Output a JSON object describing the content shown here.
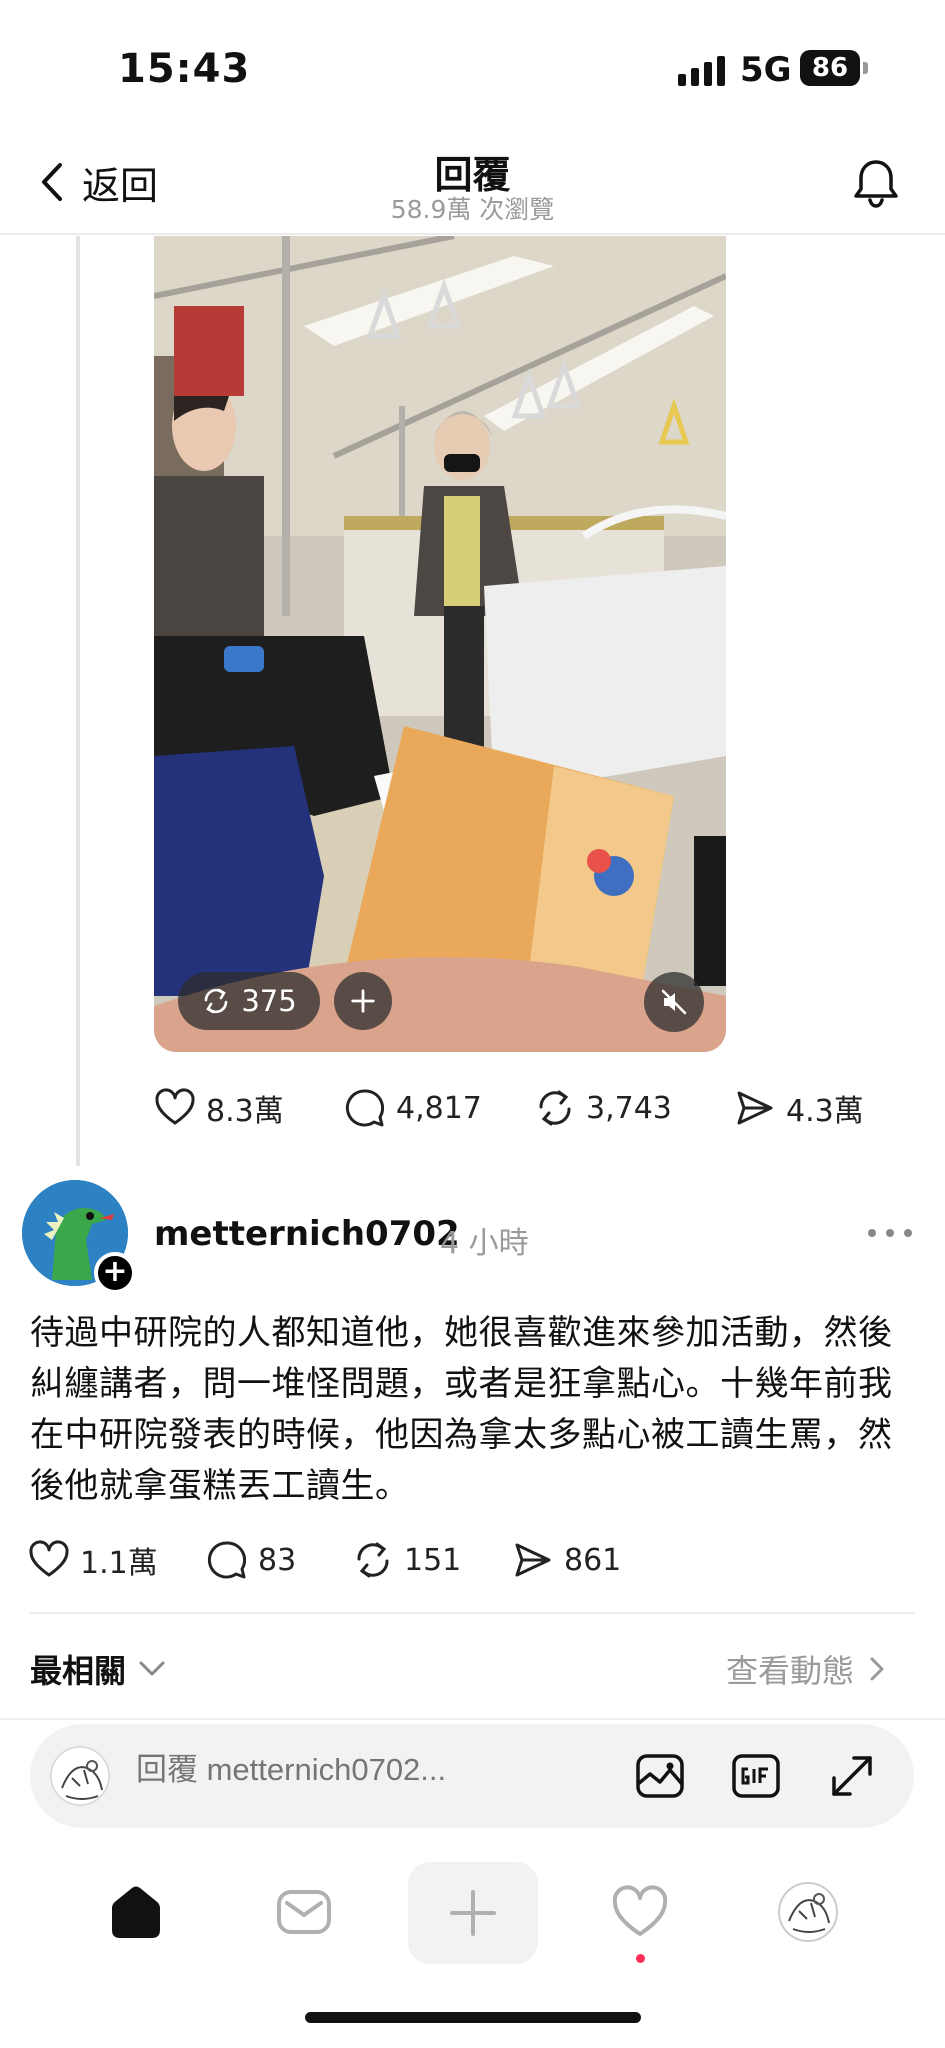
{
  "status_bar": {
    "time": "15:43",
    "network": "5G",
    "battery": "86"
  },
  "header": {
    "back_label": "返回",
    "title": "回覆",
    "subtitle": "58.9萬 次瀏覽"
  },
  "video": {
    "repost_count": "375"
  },
  "original_post_stats": {
    "likes": "8.3萬",
    "comments": "4,817",
    "reposts": "3,743",
    "shares": "4.3萬"
  },
  "reply": {
    "username": "metternich0702",
    "time_ago": "4 小時",
    "text": "待過中研院的人都知道他，她很喜歡進來參加活動，然後糾纏講者，問一堆怪問題，或者是狂拿點心。十幾年前我在中研院發表的時候，他因為拿太多點心被工讀生罵，然後他就拿蛋糕丟工讀生。",
    "likes": "1.1萬",
    "comments": "83",
    "reposts": "151",
    "shares": "861"
  },
  "sort": {
    "label": "最相關",
    "view_activity": "查看動態"
  },
  "composer": {
    "placeholder": "回覆 metternich0702..."
  },
  "colors": {
    "notification_dot": "#ff2d55",
    "avatar_bg": "#2d82c4"
  }
}
